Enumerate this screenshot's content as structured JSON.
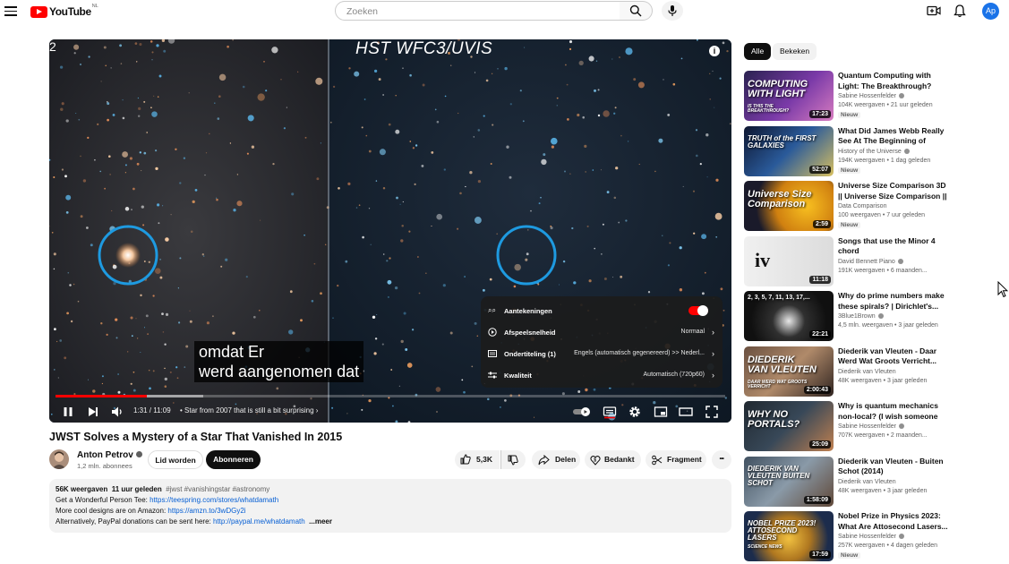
{
  "header": {
    "logo_text": "YouTube",
    "region": "NL",
    "search_placeholder": "Zoeken",
    "avatar_initials": "Ap"
  },
  "player": {
    "overlay_label": "HST WFC3/UVIS",
    "left_frame_marker": "2",
    "subtitle_line1": "omdat  Er",
    "subtitle_line2": "werd aangenomen dat",
    "progress_played_fraction": 0.136,
    "progress_buffered_fraction": 0.22,
    "time": "1:31 / 11:09",
    "chapter": "• Star from 2007 that is still a bit surprising",
    "chapter_chevron": "›",
    "settings": {
      "annotations_label": "Aantekeningen",
      "annotations_on": true,
      "speed_label": "Afspeelsnelheid",
      "speed_value": "Normaal",
      "subtitles_label": "Ondertiteling (1)",
      "subtitles_value": "Engels (automatisch gegenereerd) >> Nederl...",
      "quality_label": "Kwaliteit",
      "quality_value": "Automatisch (720p60)"
    }
  },
  "video": {
    "title": "JWST Solves a Mystery of a Star That Vanished In 2015",
    "channel_name": "Anton Petrov",
    "subscribers": "1,2 mln. abonnees",
    "join_label": "Lid worden",
    "subscribe_label": "Abonneren",
    "likes": "5,3K",
    "share_label": "Delen",
    "thanks_label": "Bedankt",
    "clip_label": "Fragment",
    "more_label": "•••"
  },
  "description": {
    "views": "56K weergaven",
    "age": "11 uur geleden",
    "hashtags": "#jwst #vanishingstar #astronomy",
    "line1_text": "Get a Wonderful Person Tee: ",
    "line1_link": "https://teespring.com/stores/whatdamath",
    "line2_text": "More cool designs are on Amazon: ",
    "line2_link": "https://amzn.to/3wDGy2i",
    "line3_text": "Alternatively, PayPal donations can be sent here: ",
    "line3_link": "http://paypal.me/whatdamath",
    "more": "...meer"
  },
  "sidebar": {
    "chips": [
      "Alle",
      "Bekeken"
    ],
    "items": [
      {
        "title": "Quantum Computing with Light: The Breakthrough?",
        "channel": "Sabine Hossenfelder",
        "verified": true,
        "meta": "104K weergaven • 21 uur geleden",
        "badge": "Nieuw",
        "duration": "17:23",
        "thumb_text": "COMPUTING WITH LIGHT",
        "thumb_sub": "IS THIS THE BREAKTHROUGH?"
      },
      {
        "title": "What Did James Webb Really See At The Beginning of Time?",
        "channel": "History of the Universe",
        "verified": true,
        "meta": "194K weergaven • 1 dag geleden",
        "badge": "Nieuw",
        "duration": "52:07",
        "thumb_text": "TRUTH of the FIRST GALAXIES"
      },
      {
        "title": "Universe Size Comparison 3D || Universe Size Comparison || 3...",
        "channel": "Data Comparison",
        "verified": false,
        "meta": "100 weergaven • 7 uur geleden",
        "badge": "Nieuw",
        "duration": "2:59",
        "thumb_text": "Universe Size Comparison"
      },
      {
        "title": "Songs that use the Minor 4 chord",
        "channel": "David Bennett Piano",
        "verified": true,
        "meta": "191K weergaven • 6 maanden...",
        "badge": "",
        "duration": "11:18",
        "thumb_text": "iv"
      },
      {
        "title": "Why do prime numbers make these spirals? | Dirichlet's...",
        "channel": "3Blue1Brown",
        "verified": true,
        "meta": "4,5 mln. weergaven • 3 jaar geleden",
        "badge": "",
        "duration": "22:21",
        "thumb_text": "2, 3, 5, 7, 11, 13, 17,..."
      },
      {
        "title": "Diederik van Vleuten - Daar Werd Wat Groots Verricht...",
        "channel": "Diederik van Vleuten",
        "verified": false,
        "meta": "48K weergaven • 3 jaar geleden",
        "badge": "",
        "duration": "2:00:43",
        "thumb_text": "DIEDERIK VAN VLEUTEN",
        "thumb_sub": "DAAR WERD WAT GROOTS VERRICHT"
      },
      {
        "title": "Why is quantum mechanics non-local? (I wish someone ha...",
        "channel": "Sabine Hossenfelder",
        "verified": true,
        "meta": "707K weergaven • 2 maanden...",
        "badge": "",
        "duration": "25:09",
        "thumb_text": "WHY NO PORTALS?"
      },
      {
        "title": "Diederik van Vleuten - Buiten Schot (2014)",
        "channel": "Diederik van Vleuten",
        "verified": false,
        "meta": "48K weergaven • 3 jaar geleden",
        "badge": "",
        "duration": "1:58:09",
        "thumb_text": "DIEDERIK VAN VLEUTEN BUITEN SCHOT"
      },
      {
        "title": "Nobel Prize in Physics 2023: What Are Attosecond Lasers...",
        "channel": "Sabine Hossenfelder",
        "verified": true,
        "meta": "257K weergaven • 4 dagen geleden",
        "badge": "Nieuw",
        "duration": "17:59",
        "thumb_text": "NOBEL PRIZE 2023! ATTOSECOND LASERS",
        "thumb_sub": "SCIENCE NEWS"
      }
    ]
  },
  "colors": {
    "brand_red": "#ff0000",
    "link_blue": "#065fd4",
    "marker_circle": "#1e9ae0"
  }
}
